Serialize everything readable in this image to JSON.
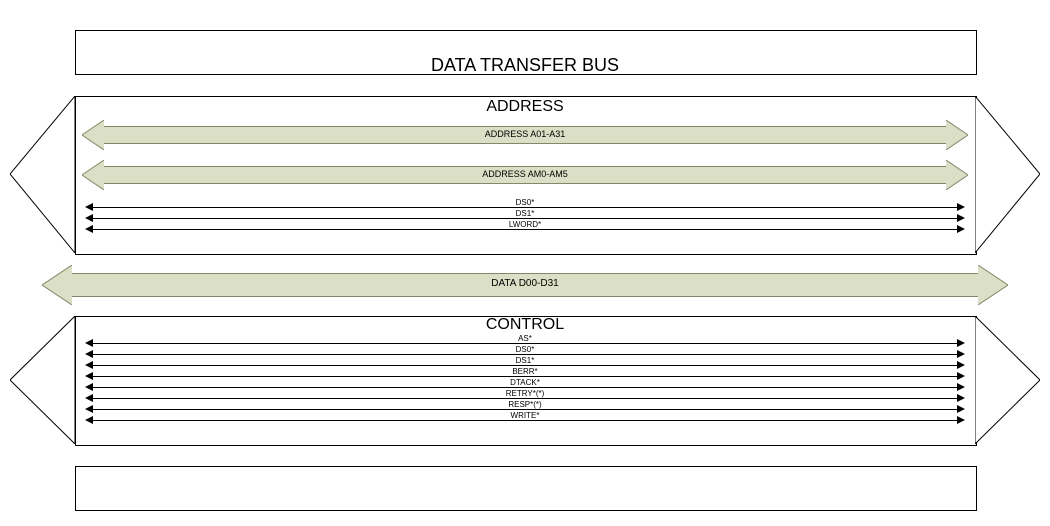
{
  "title": "DATA TRANSFER BUS",
  "sections": {
    "address": {
      "heading": "ADDRESS",
      "buses": [
        {
          "label": "ADDRESS A01-A31"
        },
        {
          "label": "ADDRESS AM0-AM5"
        }
      ],
      "signals": [
        "DS0*",
        "DS1*",
        "LWORD*"
      ]
    },
    "data": {
      "label": "DATA D00-D31"
    },
    "control": {
      "heading": "CONTROL",
      "signals": [
        "AS*",
        "DS0*",
        "DS1*",
        "BERR*",
        "DTACK*",
        "RETRY*(*)",
        "RESP*(*)",
        "WRITE*"
      ]
    }
  }
}
